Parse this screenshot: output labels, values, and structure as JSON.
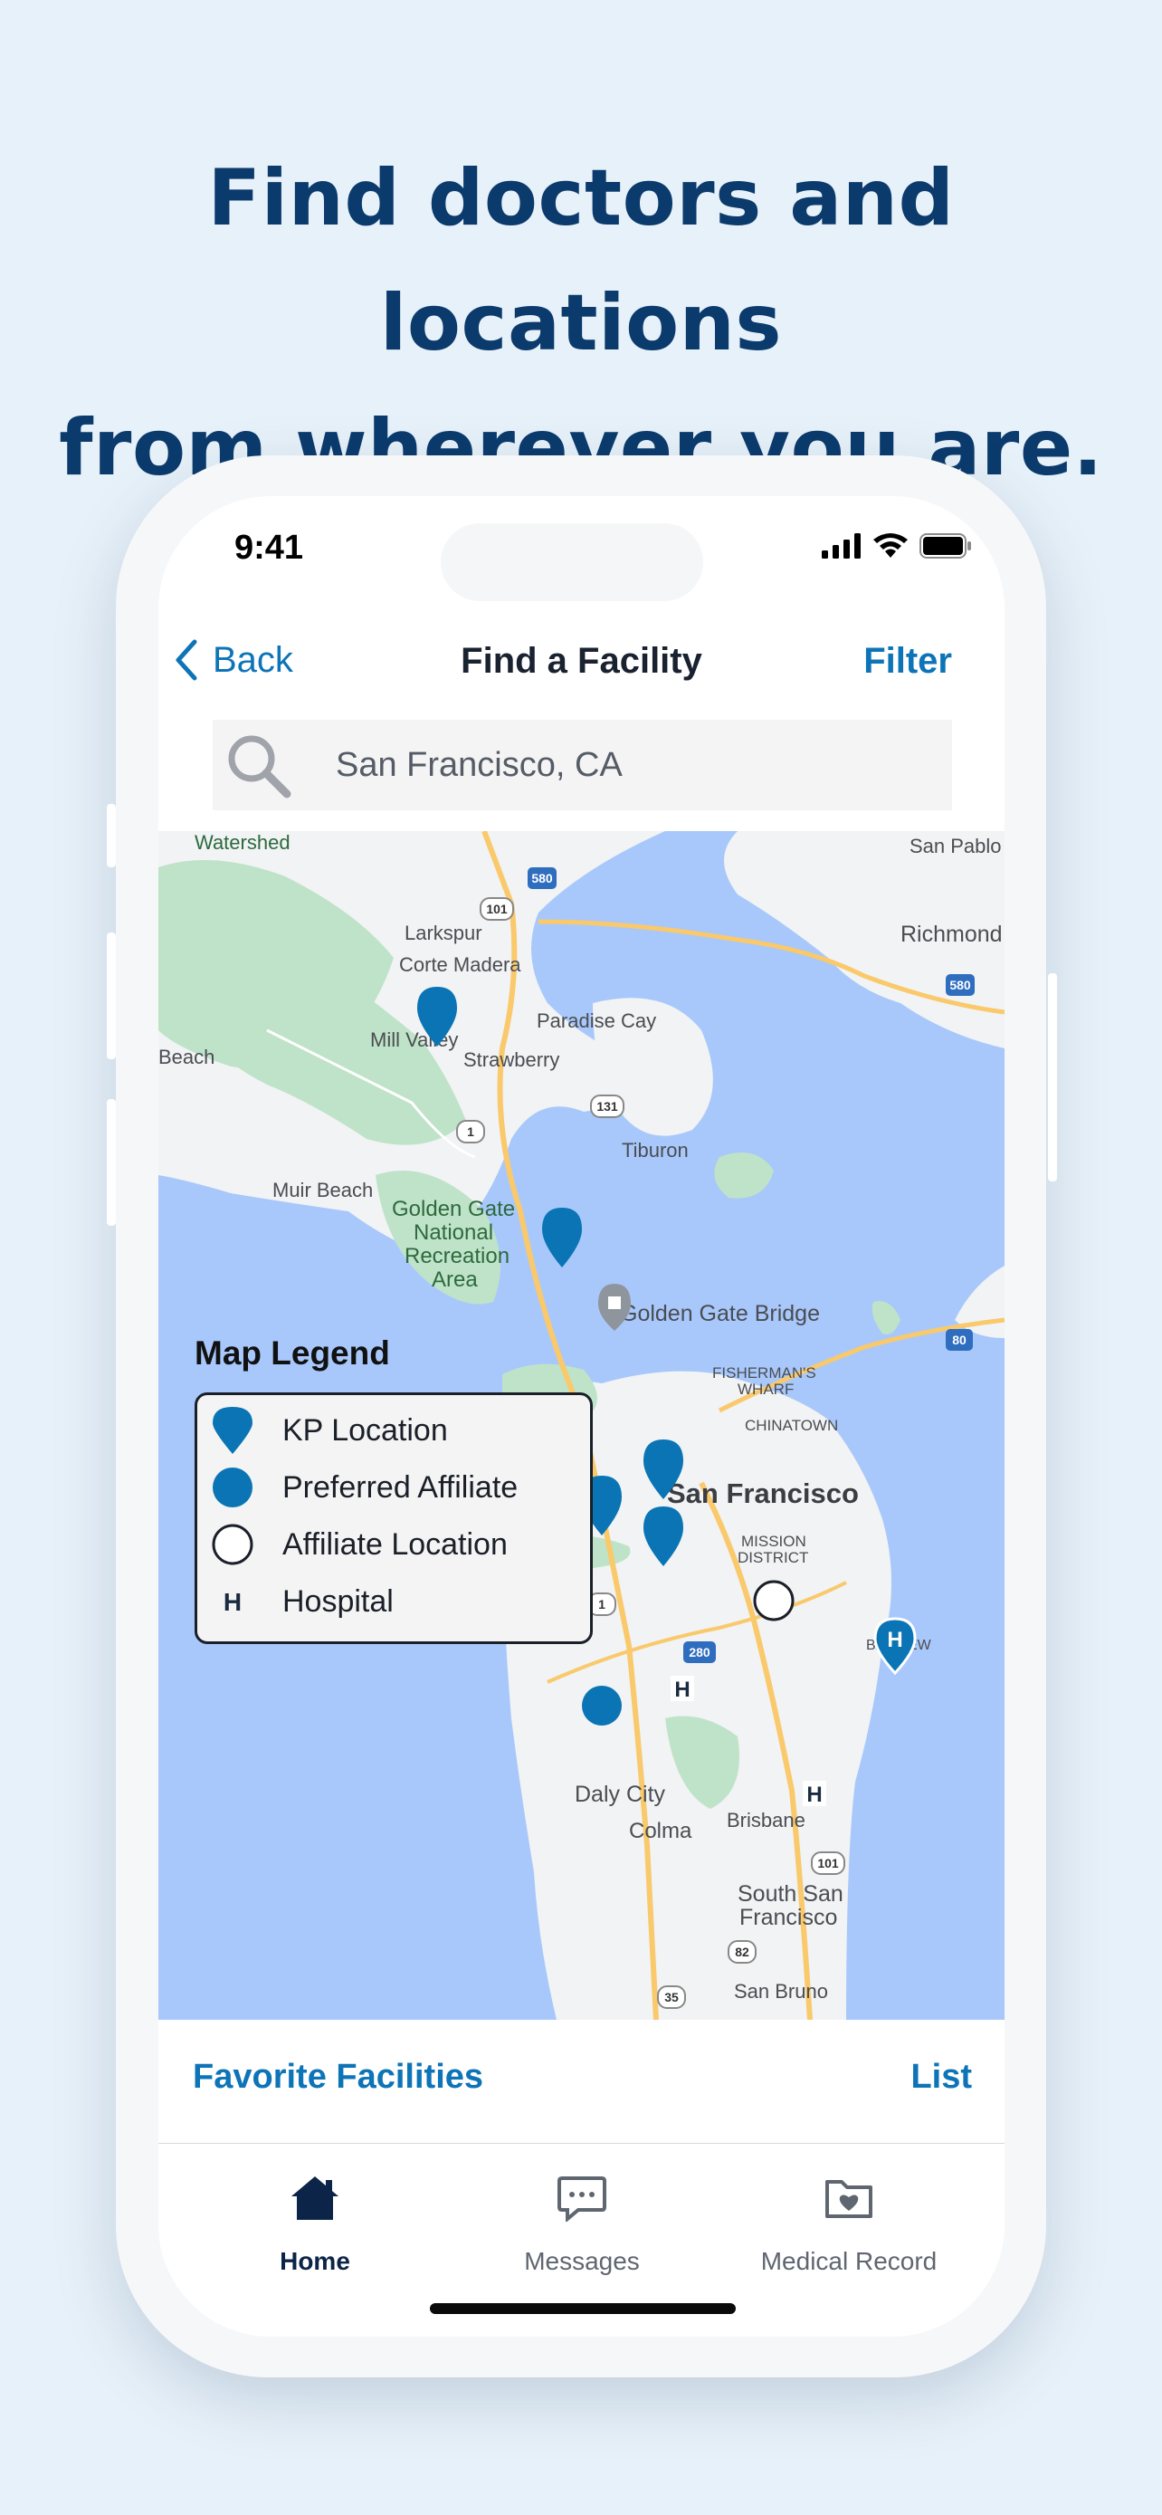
{
  "headline": {
    "line1": "Find doctors and locations",
    "line2": "from wherever you are."
  },
  "status_bar": {
    "time": "9:41"
  },
  "nav": {
    "back_label": "Back",
    "title": "Find a Facility",
    "filter_label": "Filter"
  },
  "search": {
    "value": "San Francisco, CA"
  },
  "map": {
    "places": {
      "watershed": "Watershed",
      "san_pablo": "San Pablo",
      "larkspur": "Larkspur",
      "corte_madera": "Corte Madera",
      "richmond": "Richmond",
      "paradise_cay": "Paradise Cay",
      "mill_valley": "Mill Valley",
      "strawberry": "Strawberry",
      "beach": "Beach",
      "tiburon": "Tiburon",
      "muir_beach": "Muir Beach",
      "ggnra_1": "Golden Gate",
      "ggnra_2": "National",
      "ggnra_3": "Recreation",
      "ggnra_4": "Area",
      "golden_gate_bridge": "Golden Gate Bridge",
      "fishermans_wharf_1": "FISHERMAN'S",
      "fishermans_wharf_2": "WHARF",
      "chinatown": "CHINATOWN",
      "san_francisco": "San Francisco",
      "mission_1": "MISSION",
      "mission_2": "DISTRICT",
      "bayview": "BAYVIEW",
      "daly_city": "Daly City",
      "colma": "Colma",
      "brisbane": "Brisbane",
      "south_sf_1": "South San",
      "south_sf_2": "Francisco",
      "san_bruno": "San Bruno"
    },
    "highway_shields": [
      "580",
      "101",
      "131",
      "1",
      "580",
      "80",
      "1",
      "280",
      "101",
      "82",
      "35"
    ]
  },
  "legend": {
    "title": "Map Legend",
    "items": [
      {
        "label": "KP Location",
        "symbol": "kp-pin"
      },
      {
        "label": "Preferred Affiliate",
        "symbol": "filled-circle"
      },
      {
        "label": "Affiliate Location",
        "symbol": "hollow-circle"
      },
      {
        "label": "Hospital",
        "symbol": "hospital-h"
      }
    ]
  },
  "lower_bar": {
    "favorites_label": "Favorite Facilities",
    "list_label": "List"
  },
  "tabs": [
    {
      "label": "Home",
      "icon": "house-icon",
      "active": true
    },
    {
      "label": "Messages",
      "icon": "chat-bubble-icon",
      "active": false
    },
    {
      "label": "Medical Record",
      "icon": "folder-heart-icon",
      "active": false
    }
  ],
  "colors": {
    "brand_dark": "#0b3a6c",
    "accent": "#0d74b7",
    "water": "#a8c8fb",
    "land": "#f1f3f4",
    "park": "#bfe3c8",
    "road": "#f9c96b",
    "pin": "#0a74b5"
  }
}
